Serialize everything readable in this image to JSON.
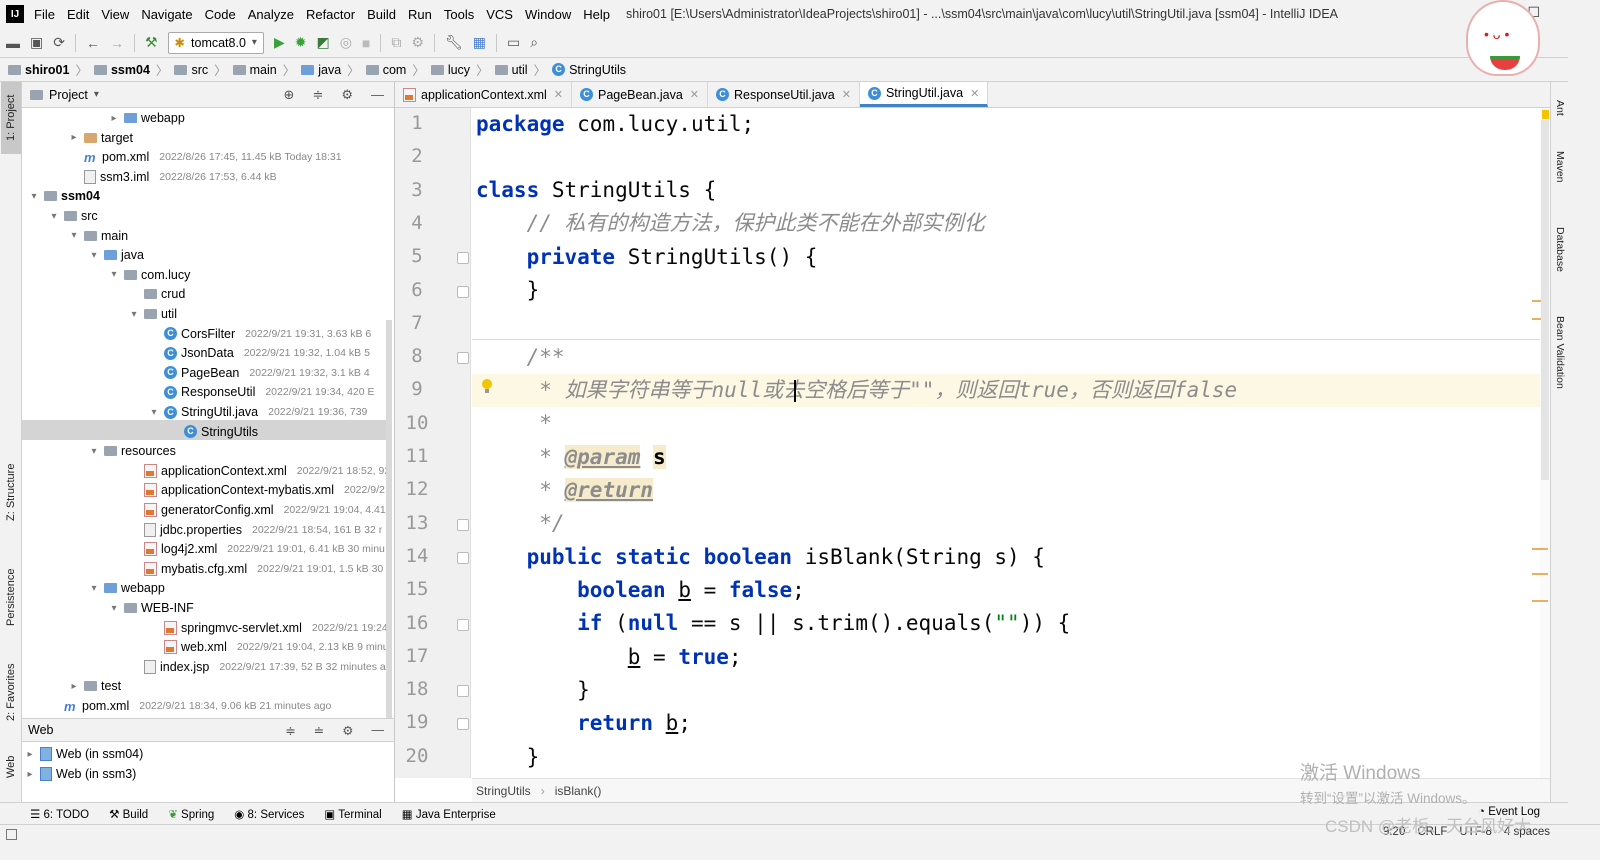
{
  "menubar": {
    "logo": "IJ",
    "items": [
      "File",
      "Edit",
      "View",
      "Navigate",
      "Code",
      "Analyze",
      "Refactor",
      "Build",
      "Run",
      "Tools",
      "VCS",
      "Window",
      "Help"
    ],
    "title": "shiro01 [E:\\Users\\Administrator\\IdeaProjects\\shiro01] - ...\\ssm04\\src\\main\\java\\com\\lucy\\util\\StringUtil.java [ssm04] - IntelliJ IDEA"
  },
  "toolbar": {
    "run_config": "tomcat8.0"
  },
  "breadcrumb": [
    "shiro01",
    "ssm04",
    "src",
    "main",
    "java",
    "com",
    "lucy",
    "util",
    "StringUtils"
  ],
  "project_panel": {
    "title": "Project"
  },
  "tree": [
    {
      "name": "webapp",
      "meta": "",
      "indent": 4,
      "arrow": "▸",
      "icon": "folder-blue"
    },
    {
      "name": "target",
      "meta": "",
      "indent": 2,
      "arrow": "▸",
      "icon": "folder-brown"
    },
    {
      "name": "pom.xml",
      "meta": "2022/8/26 17:45, 11.45 kB Today 18:31",
      "indent": 2,
      "arrow": "",
      "icon": "maven"
    },
    {
      "name": "ssm3.iml",
      "meta": "2022/8/26 17:53, 6.44 kB",
      "indent": 2,
      "arrow": "",
      "icon": "file"
    },
    {
      "name": "ssm04",
      "meta": "",
      "indent": 0,
      "arrow": "▾",
      "icon": "folder",
      "bold": true
    },
    {
      "name": "src",
      "meta": "",
      "indent": 1,
      "arrow": "▾",
      "icon": "folder"
    },
    {
      "name": "main",
      "meta": "",
      "indent": 2,
      "arrow": "▾",
      "icon": "folder"
    },
    {
      "name": "java",
      "meta": "",
      "indent": 3,
      "arrow": "▾",
      "icon": "folder-blue"
    },
    {
      "name": "com.lucy",
      "meta": "",
      "indent": 4,
      "arrow": "▾",
      "icon": "folder"
    },
    {
      "name": "crud",
      "meta": "",
      "indent": 5,
      "arrow": "",
      "icon": "folder"
    },
    {
      "name": "util",
      "meta": "",
      "indent": 5,
      "arrow": "▾",
      "icon": "folder"
    },
    {
      "name": "CorsFilter",
      "meta": "2022/9/21 19:31, 3.63 kB 6",
      "indent": 6,
      "arrow": "",
      "icon": "class"
    },
    {
      "name": "JsonData",
      "meta": "2022/9/21 19:32, 1.04 kB 5",
      "indent": 6,
      "arrow": "",
      "icon": "class"
    },
    {
      "name": "PageBean",
      "meta": "2022/9/21 19:32, 3.1 kB 4",
      "indent": 6,
      "arrow": "",
      "icon": "class"
    },
    {
      "name": "ResponseUtil",
      "meta": "2022/9/21 19:34, 420 E",
      "indent": 6,
      "arrow": "",
      "icon": "class"
    },
    {
      "name": "StringUtil.java",
      "meta": "2022/9/21 19:36, 739",
      "indent": 6,
      "arrow": "▾",
      "icon": "class"
    },
    {
      "name": "StringUtils",
      "meta": "",
      "indent": 7,
      "arrow": "",
      "icon": "class"
    },
    {
      "name": "resources",
      "meta": "",
      "indent": 3,
      "arrow": "▾",
      "icon": "folder"
    },
    {
      "name": "applicationContext.xml",
      "meta": "2022/9/21 18:52, 92",
      "indent": 5,
      "arrow": "",
      "icon": "xml"
    },
    {
      "name": "applicationContext-mybatis.xml",
      "meta": "2022/9/2",
      "indent": 5,
      "arrow": "",
      "icon": "xml"
    },
    {
      "name": "generatorConfig.xml",
      "meta": "2022/9/21 19:04, 4.41",
      "indent": 5,
      "arrow": "",
      "icon": "xml"
    },
    {
      "name": "jdbc.properties",
      "meta": "2022/9/21 18:54, 161 B 32 r",
      "indent": 5,
      "arrow": "",
      "icon": "file"
    },
    {
      "name": "log4j2.xml",
      "meta": "2022/9/21 19:01, 6.41 kB 30 minu",
      "indent": 5,
      "arrow": "",
      "icon": "xml"
    },
    {
      "name": "mybatis.cfg.xml",
      "meta": "2022/9/21 19:01, 1.5 kB 30",
      "indent": 5,
      "arrow": "",
      "icon": "xml"
    },
    {
      "name": "webapp",
      "meta": "",
      "indent": 3,
      "arrow": "▾",
      "icon": "folder-blue"
    },
    {
      "name": "WEB-INF",
      "meta": "",
      "indent": 4,
      "arrow": "▾",
      "icon": "folder"
    },
    {
      "name": "springmvc-servlet.xml",
      "meta": "2022/9/21 19:24",
      "indent": 6,
      "arrow": "",
      "icon": "xml"
    },
    {
      "name": "web.xml",
      "meta": "2022/9/21 19:04, 2.13 kB 9 minu",
      "indent": 6,
      "arrow": "",
      "icon": "xml"
    },
    {
      "name": "index.jsp",
      "meta": "2022/9/21 17:39, 52 B 32 minutes a",
      "indent": 5,
      "arrow": "",
      "icon": "file"
    },
    {
      "name": "test",
      "meta": "",
      "indent": 2,
      "arrow": "▸",
      "icon": "folder"
    },
    {
      "name": "pom.xml",
      "meta": "2022/9/21 18:34, 9.06 kB 21 minutes ago",
      "indent": 1,
      "arrow": "",
      "icon": "maven"
    }
  ],
  "web_panel": {
    "title": "Web",
    "items": [
      "Web (in ssm04)",
      "Web (in ssm3)"
    ]
  },
  "tabs": [
    {
      "label": "applicationContext.xml",
      "icon": "xml",
      "active": false
    },
    {
      "label": "PageBean.java",
      "icon": "class",
      "active": false
    },
    {
      "label": "ResponseUtil.java",
      "icon": "class",
      "active": false
    },
    {
      "label": "StringUtil.java",
      "icon": "class",
      "active": true
    }
  ],
  "line_numbers": [
    "1",
    "2",
    "3",
    "4",
    "5",
    "6",
    "7",
    "8",
    "9",
    "10",
    "11",
    "12",
    "13",
    "14",
    "15",
    "16",
    "17",
    "18",
    "19",
    "20"
  ],
  "code": {
    "l1_kw": "package",
    "l1_rest": " com.lucy.util;",
    "l3_kw": "class",
    "l3_rest": " StringUtils {",
    "l4_cm": "    // 私有的构造方法，保护此类不能在外部实例化",
    "l5_kw": "    private",
    "l5_rest": " StringUtils() {",
    "l6": "    }",
    "l8_cm": "    /**",
    "l9_cm": "     * 如果字符串等于null或去空格后等于\"\"，则返回true，否则返回false",
    "l10_cm": "     *",
    "l11_cm": "     * ",
    "l11_tag": "@param",
    "l11_sp": " ",
    "l11_param": "s",
    "l12_cm": "     * ",
    "l12_tag": "@return",
    "l13_cm": "     */",
    "l14_kw1": "    public static boolean",
    "l14_rest": " isBlank(String s) {",
    "l15_kw": "        boolean",
    "l15_sp": " ",
    "l15_var": "b",
    "l15_mid": " = ",
    "l15_kw2": "false",
    "l15_end": ";",
    "l16_kw": "        if",
    "l16_a": " (",
    "l16_null": "null",
    "l16_b": " == s || s.trim().equals(",
    "l16_str": "\"\"",
    "l16_c": ")) {",
    "l17_pre": "            ",
    "l17_var": "b",
    "l17_mid": " = ",
    "l17_kw": "true",
    "l17_end": ";",
    "l18": "        }",
    "l19_kw": "        return",
    "l19_sp": " ",
    "l19_var": "b",
    "l19_end": ";",
    "l20": "    }"
  },
  "editor_breadcrumb": [
    "StringUtils",
    "isBlank()"
  ],
  "left_tool_tabs": [
    "1: Project",
    "Z: Structure",
    "Persistence",
    "2: Favorites",
    "Web"
  ],
  "right_tool_tabs": [
    "Ant",
    "Maven",
    "Database",
    "Bean Validation"
  ],
  "bottom_tabs": [
    "6: TODO",
    "Build",
    "Spring",
    "8: Services",
    "Terminal",
    "Java Enterprise"
  ],
  "event_log": "Event Log",
  "status": {
    "position": "9:20",
    "line_sep": "CRLF",
    "encoding": "UTF-8",
    "indent": "4 spaces"
  },
  "watermark": {
    "line1": "激活 Windows",
    "line2": "转到“设置”以激活 Windows。",
    "csdn": "CSDN @老板、天台风好大"
  },
  "colors": {
    "keyword": "#0033b3",
    "comment": "#8c8c8c",
    "string": "#067d17",
    "accent": "#4083c9"
  }
}
